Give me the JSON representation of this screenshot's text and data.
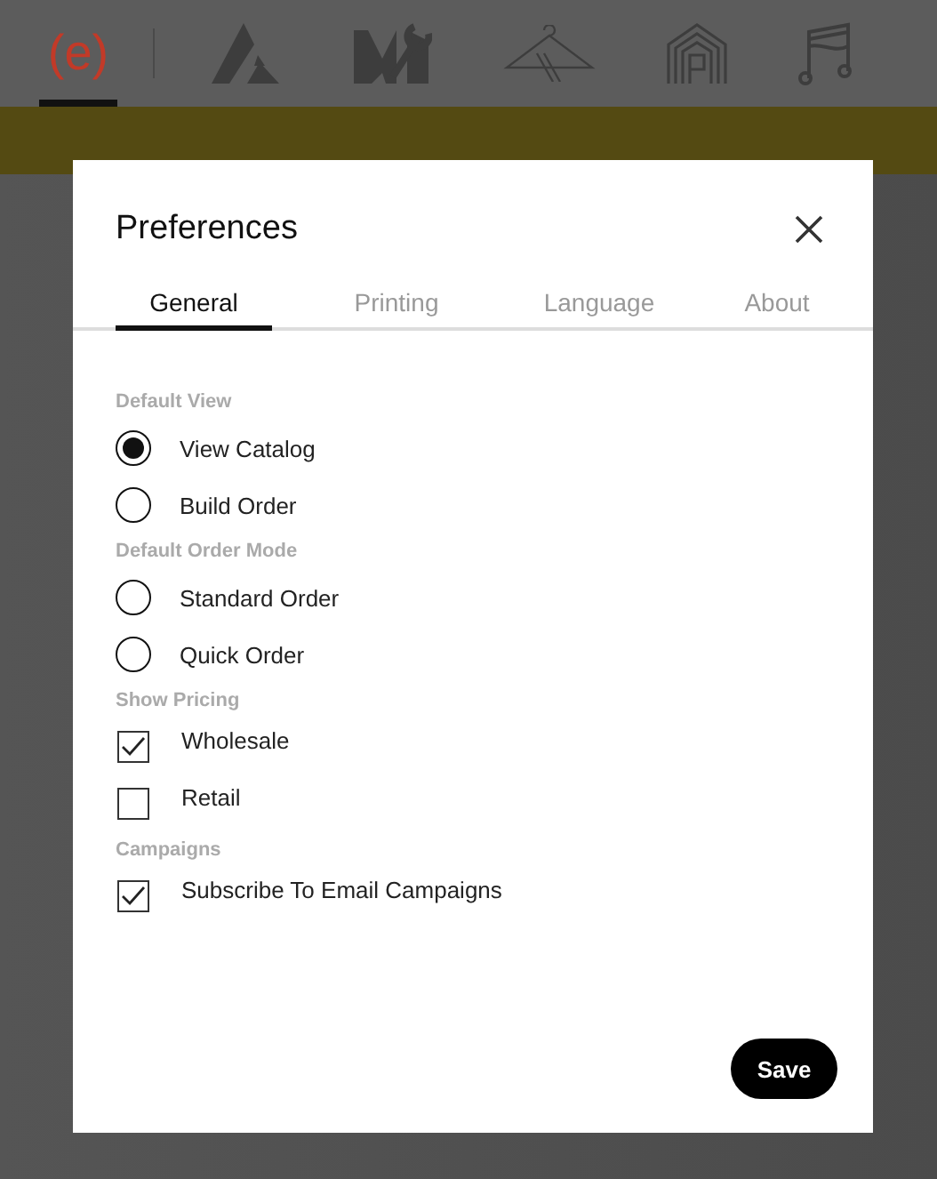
{
  "nav": [
    {
      "kind": "logo",
      "label": "(e)",
      "selected": true
    },
    {
      "kind": "app",
      "selected": false
    },
    {
      "kind": "app",
      "selected": false
    },
    {
      "kind": "app",
      "selected": false
    },
    {
      "kind": "app",
      "selected": false
    },
    {
      "kind": "app",
      "selected": false
    }
  ],
  "dialog": {
    "title": "Preferences",
    "tabs": [
      {
        "label": "General",
        "selected": true
      },
      {
        "label": "Printing",
        "selected": false
      },
      {
        "label": "Language",
        "selected": false
      },
      {
        "label": "About",
        "selected": false
      }
    ],
    "sections": [
      {
        "label": "Default View",
        "options": [
          {
            "kind": "radio",
            "label": "View Catalog",
            "selected": true
          },
          {
            "kind": "radio",
            "label": "Build Order",
            "selected": false
          }
        ]
      },
      {
        "label": "Default Order Mode",
        "options": [
          {
            "kind": "radio",
            "label": "Standard Order",
            "selected": false
          },
          {
            "kind": "radio",
            "label": "Quick Order",
            "selected": false
          }
        ]
      },
      {
        "label": "Show Pricing",
        "options": [
          {
            "kind": "checkbox",
            "label": "Wholesale",
            "checked": true
          },
          {
            "kind": "checkbox",
            "label": "Retail",
            "checked": false
          }
        ]
      },
      {
        "label": "Campaigns",
        "options": [
          {
            "kind": "checkbox",
            "label": "Subscribe To Email Campaigns",
            "checked": true
          }
        ]
      }
    ],
    "save_button": "Save"
  }
}
